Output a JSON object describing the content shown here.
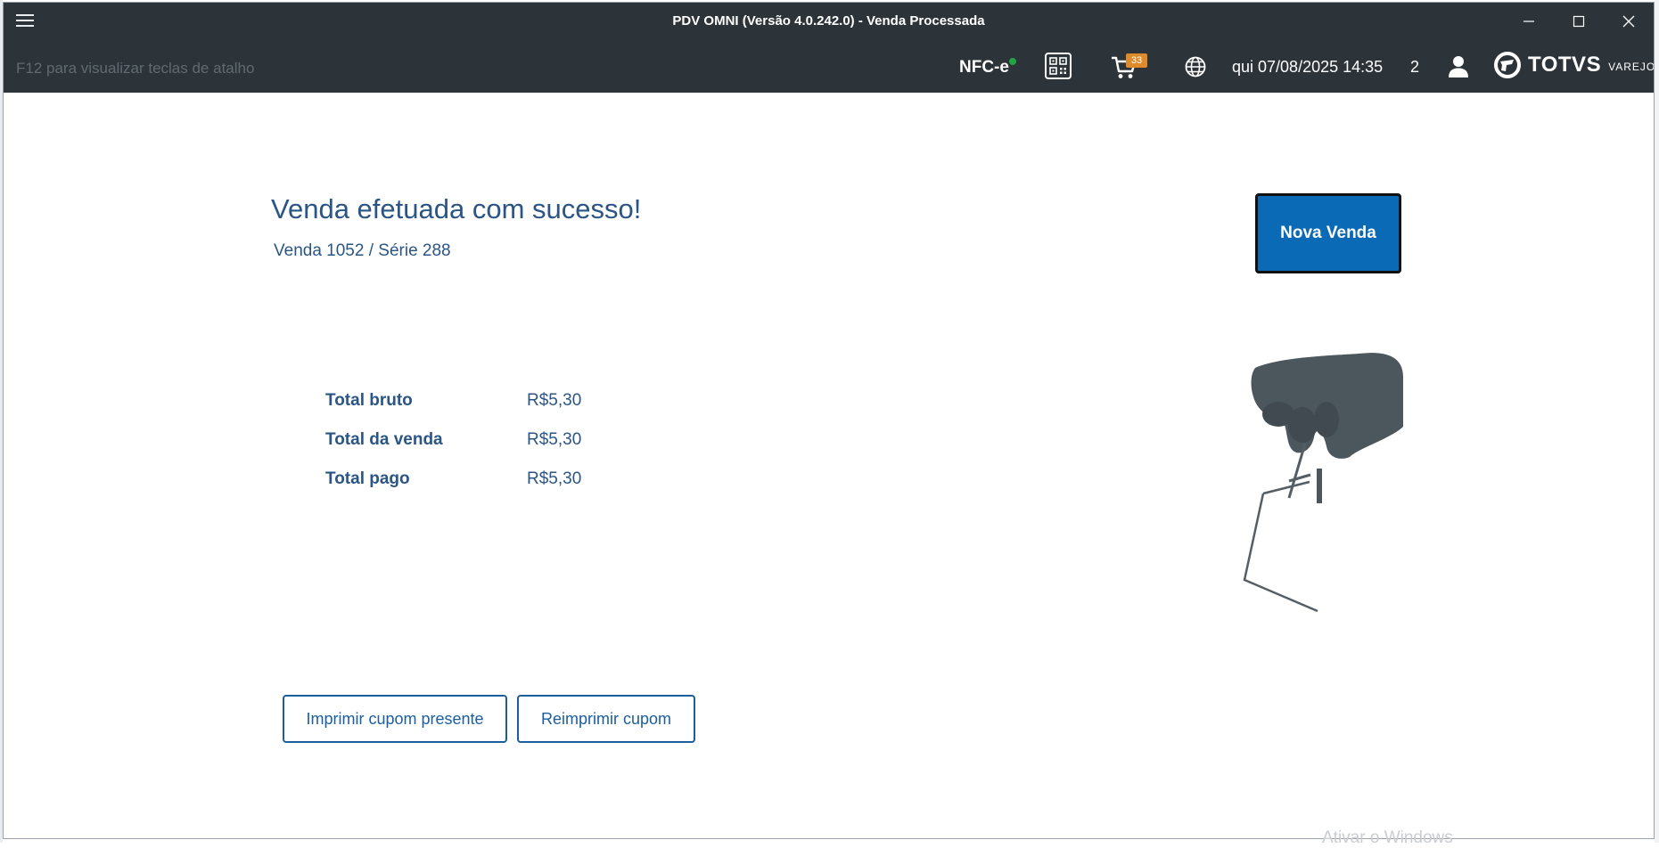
{
  "window": {
    "title": "PDV OMNI (Versão 4.0.242.0) - Venda Processada"
  },
  "toolbar": {
    "shortcut_hint": "F12 para visualizar teclas de atalho",
    "nfce_label": "NFC-e",
    "cart_count": "33",
    "datetime": "qui 07/08/2025 14:35",
    "user_count": "2",
    "brand_name": "TOTVS",
    "brand_sub": "VAREJO"
  },
  "main": {
    "success_title": "Venda efetuada com sucesso!",
    "sale_info": "Venda 1052 / Série 288",
    "totals": [
      {
        "label": "Total bruto",
        "value": "R$5,30"
      },
      {
        "label": "Total da venda",
        "value": "R$5,30"
      },
      {
        "label": "Total pago",
        "value": "R$5,30"
      }
    ],
    "new_sale_button": "Nova Venda",
    "print_gift_button": "Imprimir cupom presente",
    "reprint_button": "Reimprimir cupom"
  },
  "os": {
    "watermark": "Ativar o Windows"
  },
  "colors": {
    "header_bg": "#2d3439",
    "accent_blue": "#0b6ab5",
    "text_blue": "#2a5585",
    "status_green": "#22a344",
    "badge_orange": "#e08b2a"
  }
}
